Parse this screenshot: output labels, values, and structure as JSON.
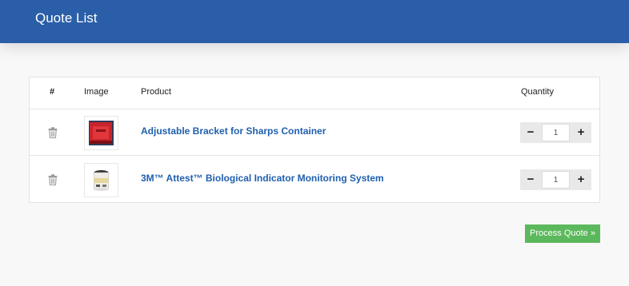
{
  "header": {
    "title": "Quote List"
  },
  "table": {
    "columns": {
      "hash": "#",
      "image": "Image",
      "product": "Product",
      "quantity": "Quantity"
    },
    "rows": [
      {
        "product": "Adjustable Bracket for Sharps Container",
        "quantity": "1",
        "image_icon": "red-bracket-thumbnail"
      },
      {
        "product": "3M™ Attest™ Biological Indicator Monitoring System",
        "quantity": "1",
        "image_icon": "indicator-vial-thumbnail"
      }
    ],
    "qty_minus": "−",
    "qty_plus": "+"
  },
  "actions": {
    "process_quote": "Process Quote »"
  },
  "colors": {
    "header": "#2b5ea8",
    "link": "#1f5fae",
    "process_button": "#5cb85c"
  }
}
